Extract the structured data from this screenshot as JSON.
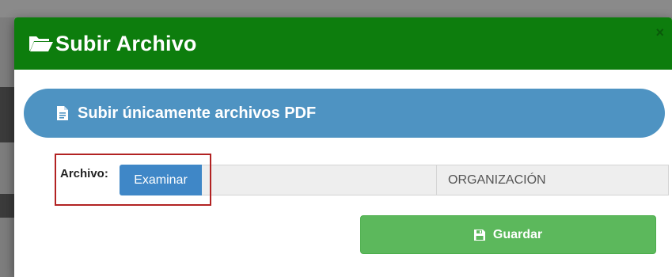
{
  "modal": {
    "title": "Subir Archivo",
    "close_label": "×",
    "folder_icon": "folder-open-icon"
  },
  "banner": {
    "text": "Subir únicamente archivos PDF",
    "icon": "file-document-icon",
    "color": "#4e93c2"
  },
  "form": {
    "file_label": "Archivo:",
    "browse_label": "Examinar",
    "file_path_value": "",
    "org_value": "ORGANIZACIÓN"
  },
  "actions": {
    "save_label": "Guardar",
    "save_icon": "floppy-disk-icon"
  },
  "colors": {
    "header": "#0d7d0d",
    "save": "#5cb85c",
    "browse": "#3f87c7",
    "highlight": "#b22222"
  }
}
